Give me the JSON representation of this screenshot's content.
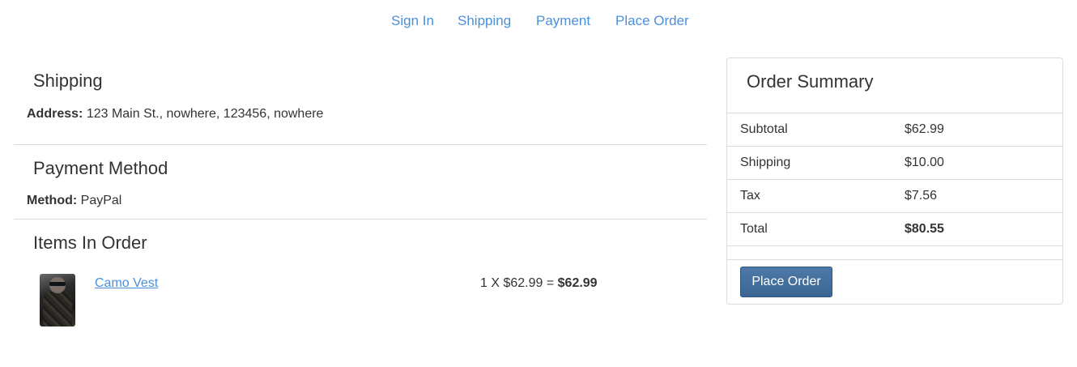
{
  "steps": {
    "sign_in": "Sign In",
    "shipping": "Shipping",
    "payment": "Payment",
    "place_order": "Place Order"
  },
  "shipping": {
    "title": "Shipping",
    "address_label": "Address:",
    "address_value": "123 Main St., nowhere, 123456, nowhere"
  },
  "payment": {
    "title": "Payment Method",
    "method_label": "Method:",
    "method_value": "PayPal"
  },
  "items": {
    "title": "Items In Order",
    "list": [
      {
        "name": "Camo Vest",
        "qty_price": "1 X $62.99 = ",
        "line_total": "$62.99"
      }
    ]
  },
  "summary": {
    "title": "Order Summary",
    "rows": [
      {
        "label": "Subtotal",
        "value": "$62.99"
      },
      {
        "label": "Shipping",
        "value": "$10.00"
      },
      {
        "label": "Tax",
        "value": "$7.56"
      },
      {
        "label": "Total",
        "value": "$80.55"
      }
    ],
    "place_order_label": "Place Order"
  },
  "colors": {
    "link": "#4a90d9",
    "button": "#3c6692",
    "border": "#dcdcdc",
    "text": "#333333"
  }
}
